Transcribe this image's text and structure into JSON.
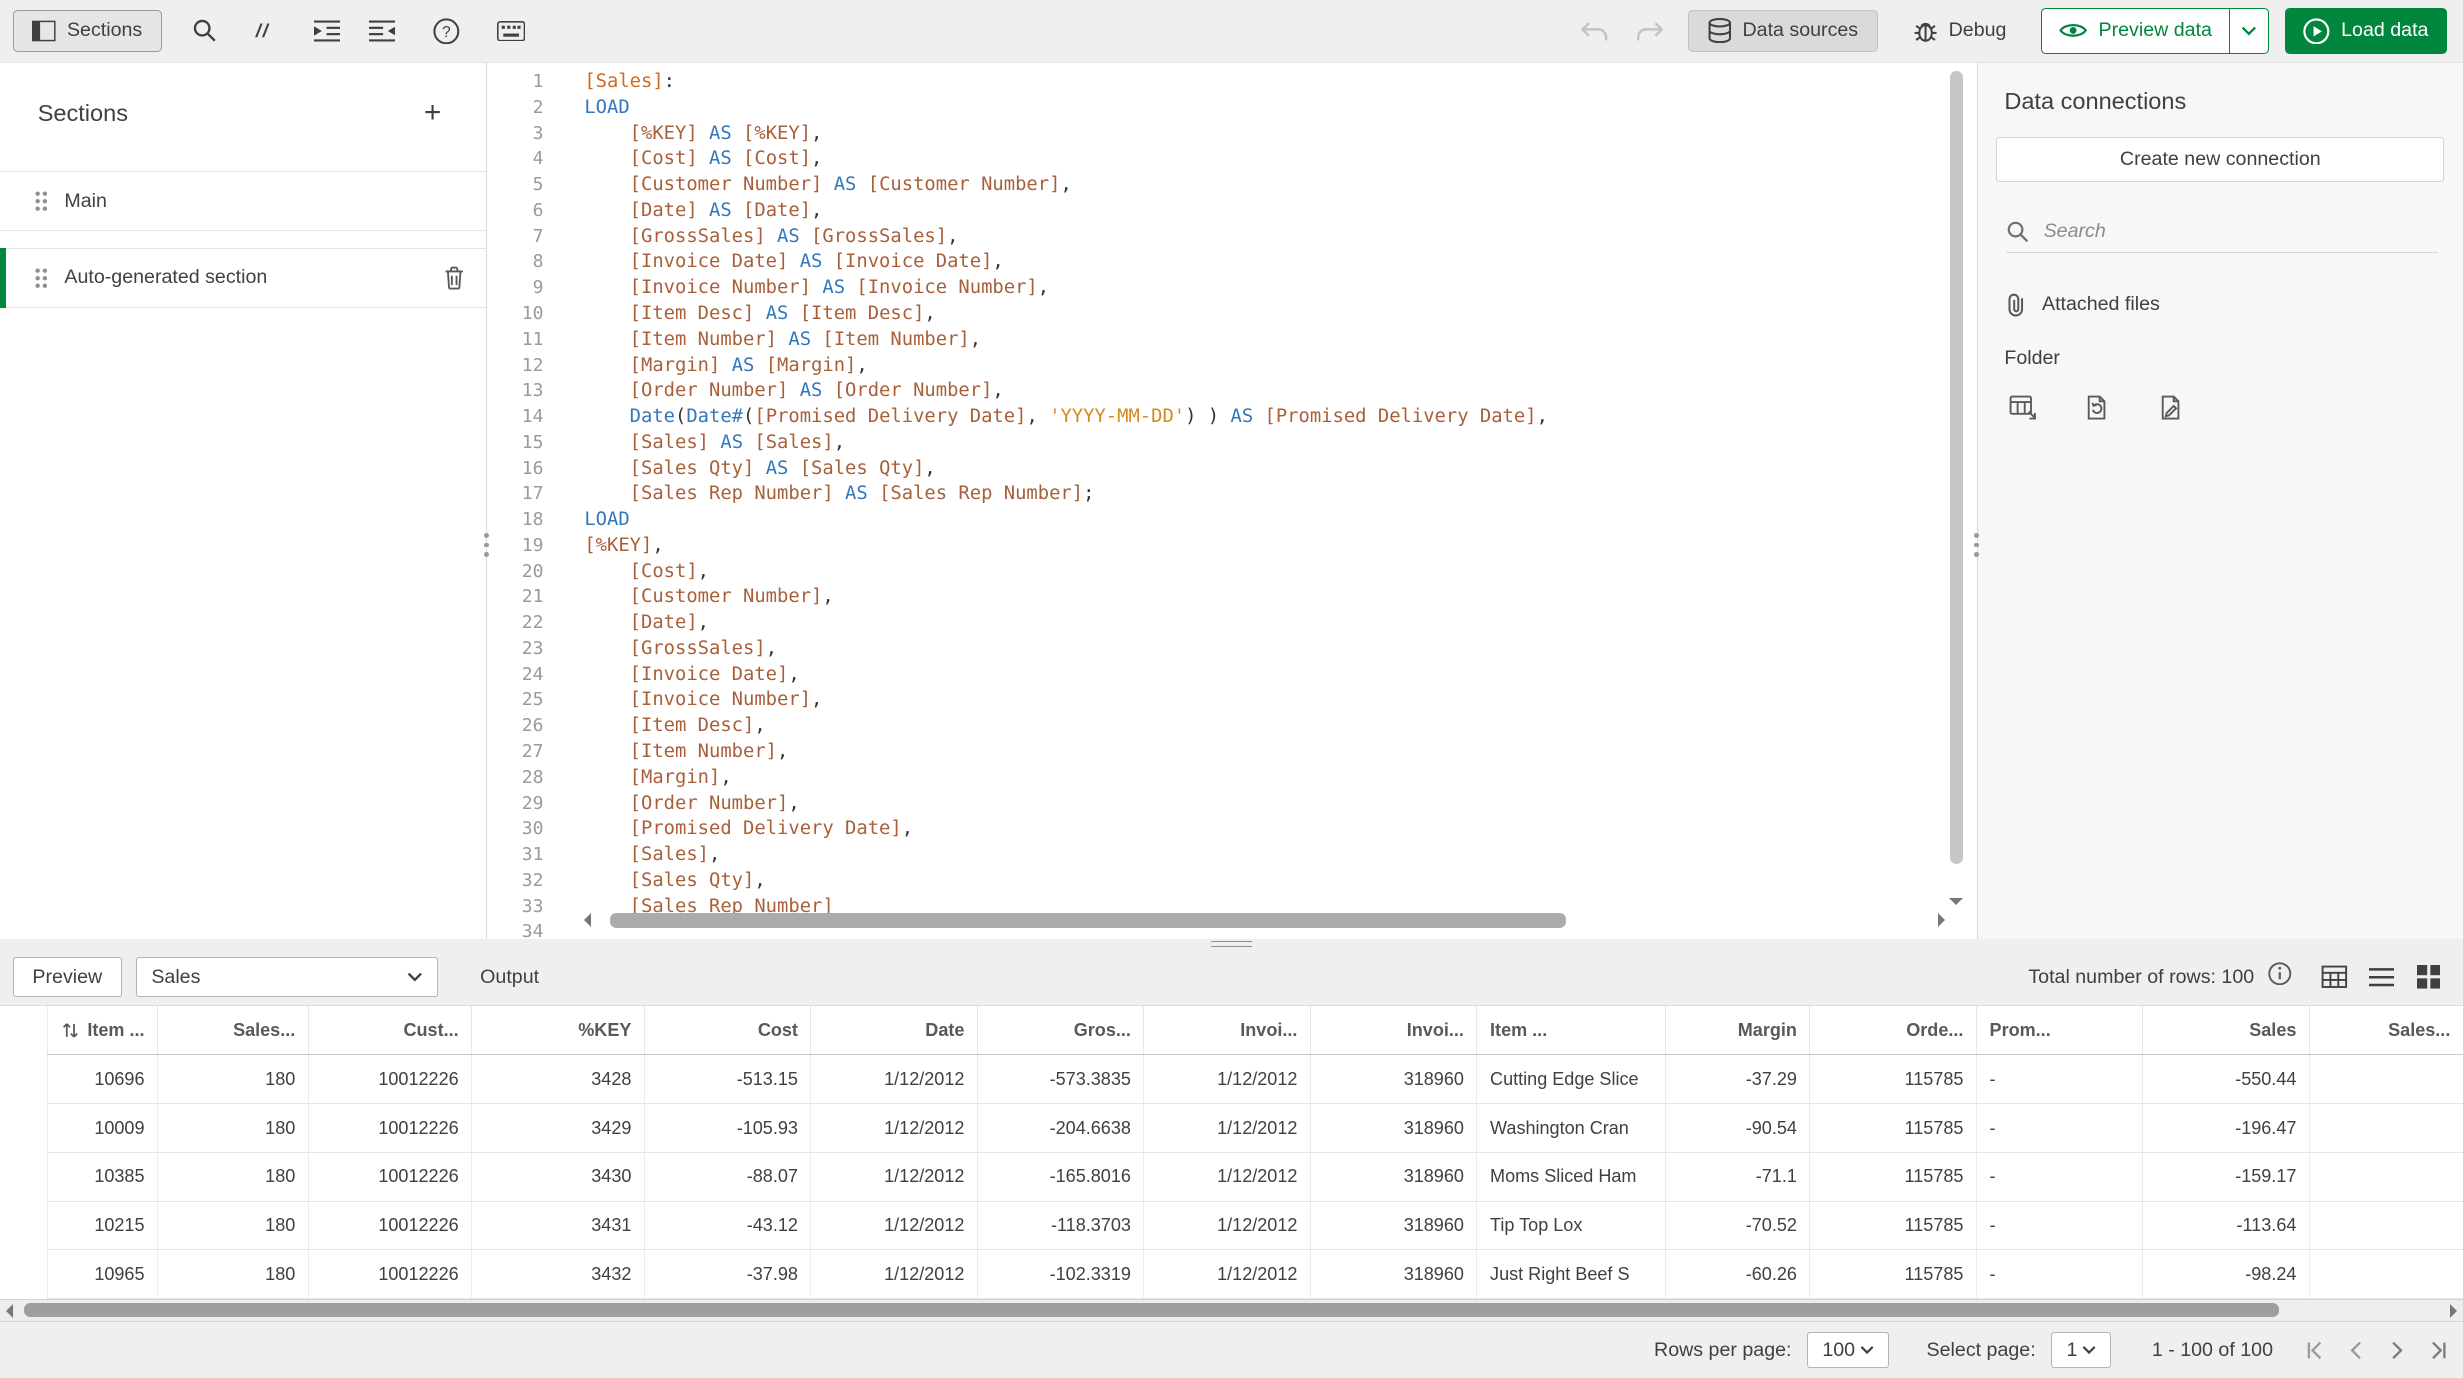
{
  "accent_color": "#00873d",
  "toolbar": {
    "sections_label": "Sections",
    "data_sources_label": "Data sources",
    "debug_label": "Debug",
    "preview_data_label": "Preview data",
    "load_data_label": "Load data"
  },
  "icons": {
    "comment_glyph": "//",
    "help_glyph": "?",
    "plus_glyph": "+"
  },
  "sections_panel": {
    "title": "Sections",
    "items": [
      {
        "label": "Main",
        "selected": false
      },
      {
        "label": "Auto-generated section",
        "selected": true
      }
    ]
  },
  "editor": {
    "colors": {
      "keyword": "#3377bb",
      "field": "#a8603a",
      "string": "#d4881e",
      "table": "#d2691e",
      "plain": "#333333",
      "line_number": "#9a9a9a"
    },
    "lines": [
      [
        [
          "t",
          "[Sales]"
        ],
        [
          "p",
          ":"
        ]
      ],
      [
        [
          "k",
          "LOAD"
        ]
      ],
      [
        [
          "p",
          "    "
        ],
        [
          "f",
          "[%KEY]"
        ],
        [
          "p",
          " "
        ],
        [
          "k",
          "AS"
        ],
        [
          "p",
          " "
        ],
        [
          "f",
          "[%KEY]"
        ],
        [
          "p",
          ","
        ]
      ],
      [
        [
          "p",
          "    "
        ],
        [
          "f",
          "[Cost]"
        ],
        [
          "p",
          " "
        ],
        [
          "k",
          "AS"
        ],
        [
          "p",
          " "
        ],
        [
          "f",
          "[Cost]"
        ],
        [
          "p",
          ","
        ]
      ],
      [
        [
          "p",
          "    "
        ],
        [
          "f",
          "[Customer Number]"
        ],
        [
          "p",
          " "
        ],
        [
          "k",
          "AS"
        ],
        [
          "p",
          " "
        ],
        [
          "f",
          "[Customer Number]"
        ],
        [
          "p",
          ","
        ]
      ],
      [
        [
          "p",
          "    "
        ],
        [
          "f",
          "[Date]"
        ],
        [
          "p",
          " "
        ],
        [
          "k",
          "AS"
        ],
        [
          "p",
          " "
        ],
        [
          "f",
          "[Date]"
        ],
        [
          "p",
          ","
        ]
      ],
      [
        [
          "p",
          "    "
        ],
        [
          "f",
          "[GrossSales]"
        ],
        [
          "p",
          " "
        ],
        [
          "k",
          "AS"
        ],
        [
          "p",
          " "
        ],
        [
          "f",
          "[GrossSales]"
        ],
        [
          "p",
          ","
        ]
      ],
      [
        [
          "p",
          "    "
        ],
        [
          "f",
          "[Invoice Date]"
        ],
        [
          "p",
          " "
        ],
        [
          "k",
          "AS"
        ],
        [
          "p",
          " "
        ],
        [
          "f",
          "[Invoice Date]"
        ],
        [
          "p",
          ","
        ]
      ],
      [
        [
          "p",
          "    "
        ],
        [
          "f",
          "[Invoice Number]"
        ],
        [
          "p",
          " "
        ],
        [
          "k",
          "AS"
        ],
        [
          "p",
          " "
        ],
        [
          "f",
          "[Invoice Number]"
        ],
        [
          "p",
          ","
        ]
      ],
      [
        [
          "p",
          "    "
        ],
        [
          "f",
          "[Item Desc]"
        ],
        [
          "p",
          " "
        ],
        [
          "k",
          "AS"
        ],
        [
          "p",
          " "
        ],
        [
          "f",
          "[Item Desc]"
        ],
        [
          "p",
          ","
        ]
      ],
      [
        [
          "p",
          "    "
        ],
        [
          "f",
          "[Item Number]"
        ],
        [
          "p",
          " "
        ],
        [
          "k",
          "AS"
        ],
        [
          "p",
          " "
        ],
        [
          "f",
          "[Item Number]"
        ],
        [
          "p",
          ","
        ]
      ],
      [
        [
          "p",
          "    "
        ],
        [
          "f",
          "[Margin]"
        ],
        [
          "p",
          " "
        ],
        [
          "k",
          "AS"
        ],
        [
          "p",
          " "
        ],
        [
          "f",
          "[Margin]"
        ],
        [
          "p",
          ","
        ]
      ],
      [
        [
          "p",
          "    "
        ],
        [
          "f",
          "[Order Number]"
        ],
        [
          "p",
          " "
        ],
        [
          "k",
          "AS"
        ],
        [
          "p",
          " "
        ],
        [
          "f",
          "[Order Number]"
        ],
        [
          "p",
          ","
        ]
      ],
      [
        [
          "p",
          "    "
        ],
        [
          "n",
          "Date"
        ],
        [
          "p",
          "("
        ],
        [
          "n",
          "Date#"
        ],
        [
          "p",
          "("
        ],
        [
          "f",
          "[Promised Delivery Date]"
        ],
        [
          "p",
          ", "
        ],
        [
          "s",
          "'YYYY-MM-DD'"
        ],
        [
          "p",
          ") ) "
        ],
        [
          "k",
          "AS"
        ],
        [
          "p",
          " "
        ],
        [
          "f",
          "[Promised Delivery Date]"
        ],
        [
          "p",
          ","
        ]
      ],
      [
        [
          "p",
          "    "
        ],
        [
          "f",
          "[Sales]"
        ],
        [
          "p",
          " "
        ],
        [
          "k",
          "AS"
        ],
        [
          "p",
          " "
        ],
        [
          "f",
          "[Sales]"
        ],
        [
          "p",
          ","
        ]
      ],
      [
        [
          "p",
          "    "
        ],
        [
          "f",
          "[Sales Qty]"
        ],
        [
          "p",
          " "
        ],
        [
          "k",
          "AS"
        ],
        [
          "p",
          " "
        ],
        [
          "f",
          "[Sales Qty]"
        ],
        [
          "p",
          ","
        ]
      ],
      [
        [
          "p",
          "    "
        ],
        [
          "f",
          "[Sales Rep Number]"
        ],
        [
          "p",
          " "
        ],
        [
          "k",
          "AS"
        ],
        [
          "p",
          " "
        ],
        [
          "f",
          "[Sales Rep Number]"
        ],
        [
          "p",
          ";"
        ]
      ],
      [
        [
          "k",
          "LOAD"
        ]
      ],
      [
        [
          "f",
          "[%KEY]"
        ],
        [
          "p",
          ","
        ]
      ],
      [
        [
          "p",
          "    "
        ],
        [
          "f",
          "[Cost]"
        ],
        [
          "p",
          ","
        ]
      ],
      [
        [
          "p",
          "    "
        ],
        [
          "f",
          "[Customer Number]"
        ],
        [
          "p",
          ","
        ]
      ],
      [
        [
          "p",
          "    "
        ],
        [
          "f",
          "[Date]"
        ],
        [
          "p",
          ","
        ]
      ],
      [
        [
          "p",
          "    "
        ],
        [
          "f",
          "[GrossSales]"
        ],
        [
          "p",
          ","
        ]
      ],
      [
        [
          "p",
          "    "
        ],
        [
          "f",
          "[Invoice Date]"
        ],
        [
          "p",
          ","
        ]
      ],
      [
        [
          "p",
          "    "
        ],
        [
          "f",
          "[Invoice Number]"
        ],
        [
          "p",
          ","
        ]
      ],
      [
        [
          "p",
          "    "
        ],
        [
          "f",
          "[Item Desc]"
        ],
        [
          "p",
          ","
        ]
      ],
      [
        [
          "p",
          "    "
        ],
        [
          "f",
          "[Item Number]"
        ],
        [
          "p",
          ","
        ]
      ],
      [
        [
          "p",
          "    "
        ],
        [
          "f",
          "[Margin]"
        ],
        [
          "p",
          ","
        ]
      ],
      [
        [
          "p",
          "    "
        ],
        [
          "f",
          "[Order Number]"
        ],
        [
          "p",
          ","
        ]
      ],
      [
        [
          "p",
          "    "
        ],
        [
          "f",
          "[Promised Delivery Date]"
        ],
        [
          "p",
          ","
        ]
      ],
      [
        [
          "p",
          "    "
        ],
        [
          "f",
          "[Sales]"
        ],
        [
          "p",
          ","
        ]
      ],
      [
        [
          "p",
          "    "
        ],
        [
          "f",
          "[Sales Qty]"
        ],
        [
          "p",
          ","
        ]
      ],
      [
        [
          "p",
          "    "
        ],
        [
          "f",
          "[Sales Rep Number]"
        ]
      ],
      []
    ]
  },
  "connections_panel": {
    "title": "Data connections",
    "create_button_label": "Create new connection",
    "search_placeholder": "Search",
    "attached_files_label": "Attached files",
    "folder_label": "Folder"
  },
  "preview": {
    "preview_button_label": "Preview",
    "table_selector_value": "Sales",
    "output_button_label": "Output",
    "total_rows_label": "Total number of rows: 100"
  },
  "table": {
    "columns": [
      {
        "label": "Item ...",
        "align": "right"
      },
      {
        "label": "Sales...",
        "align": "right"
      },
      {
        "label": "Cust...",
        "align": "right"
      },
      {
        "label": "%KEY",
        "align": "right"
      },
      {
        "label": "Cost",
        "align": "right"
      },
      {
        "label": "Date",
        "align": "right"
      },
      {
        "label": "Gros...",
        "align": "right"
      },
      {
        "label": "Invoi...",
        "align": "right"
      },
      {
        "label": "Invoi...",
        "align": "right"
      },
      {
        "label": "Item ...",
        "align": "left"
      },
      {
        "label": "Margin",
        "align": "right"
      },
      {
        "label": "Orde...",
        "align": "right"
      },
      {
        "label": "Prom...",
        "align": "left"
      },
      {
        "label": "Sales",
        "align": "right"
      },
      {
        "label": "Sales...",
        "align": "right"
      }
    ],
    "rows": [
      [
        "10696",
        "180",
        "10012226",
        "3428",
        "-513.15",
        "1/12/2012",
        "-573.3835",
        "1/12/2012",
        "318960",
        "Cutting Edge Slice",
        "-37.29",
        "115785",
        "-",
        "-550.44",
        ""
      ],
      [
        "10009",
        "180",
        "10012226",
        "3429",
        "-105.93",
        "1/12/2012",
        "-204.6638",
        "1/12/2012",
        "318960",
        "Washington Cran",
        "-90.54",
        "115785",
        "-",
        "-196.47",
        ""
      ],
      [
        "10385",
        "180",
        "10012226",
        "3430",
        "-88.07",
        "1/12/2012",
        "-165.8016",
        "1/12/2012",
        "318960",
        "Moms Sliced Ham",
        "-71.1",
        "115785",
        "-",
        "-159.17",
        ""
      ],
      [
        "10215",
        "180",
        "10012226",
        "3431",
        "-43.12",
        "1/12/2012",
        "-118.3703",
        "1/12/2012",
        "318960",
        "Tip Top Lox",
        "-70.52",
        "115785",
        "-",
        "-113.64",
        ""
      ],
      [
        "10965",
        "180",
        "10012226",
        "3432",
        "-37.98",
        "1/12/2012",
        "-102.3319",
        "1/12/2012",
        "318960",
        "Just Right Beef S",
        "-60.26",
        "115785",
        "-",
        "-98.24",
        ""
      ]
    ]
  },
  "pagination": {
    "rows_per_page_label": "Rows per page:",
    "rows_per_page_value": "100",
    "select_page_label": "Select page:",
    "select_page_value": "1",
    "range_label": "1 - 100 of 100"
  }
}
